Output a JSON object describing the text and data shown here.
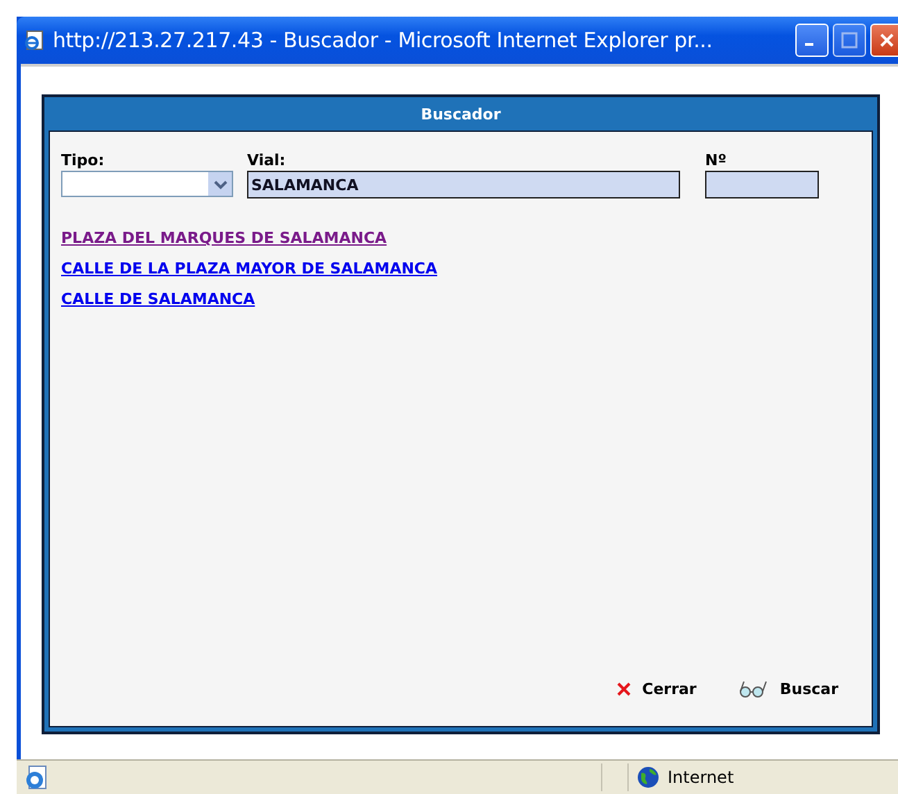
{
  "window": {
    "title": "http://213.27.217.43 - Buscador - Microsoft Internet Explorer pr..."
  },
  "panel": {
    "title": "Buscador"
  },
  "form": {
    "tipo": {
      "label": "Tipo:"
    },
    "vial": {
      "label": "Vial:",
      "value": "SALAMANCA"
    },
    "numero": {
      "label": "Nº"
    }
  },
  "results": [
    {
      "text": "PLAZA DEL MARQUES DE SALAMANCA",
      "visited": true
    },
    {
      "text": "CALLE DE LA PLAZA MAYOR DE SALAMANCA",
      "visited": false
    },
    {
      "text": "CALLE DE SALAMANCA",
      "visited": false
    }
  ],
  "buttons": [
    {
      "kind": "close",
      "label": "Cerrar"
    },
    {
      "kind": "search",
      "label": "Buscar"
    }
  ],
  "status_bar": {
    "zone": "Internet"
  }
}
